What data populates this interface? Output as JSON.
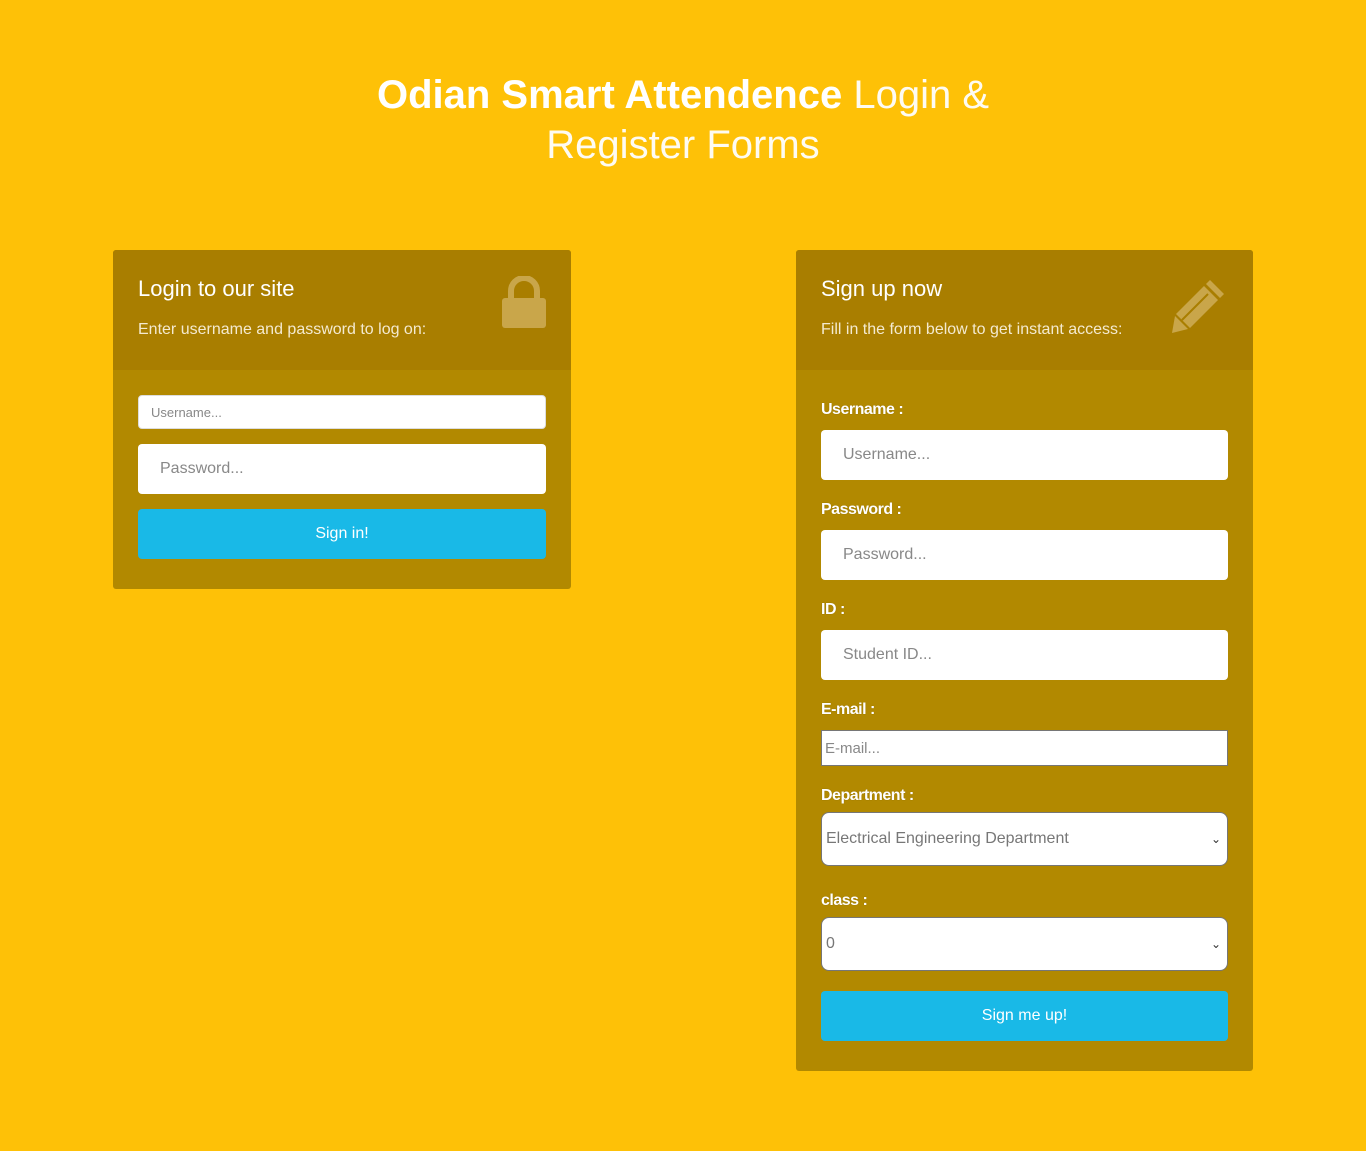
{
  "header": {
    "title_strong": "Odian Smart Attendence",
    "title_light": "Login & Register Forms"
  },
  "login": {
    "heading": "Login to our site",
    "subheading": "Enter username and password to log on:",
    "icon": "lock-icon",
    "username_placeholder": "Username...",
    "password_placeholder": "Password...",
    "submit_label": "Sign in!"
  },
  "signup": {
    "heading": "Sign up now",
    "subheading": "Fill in the form below to get instant access:",
    "icon": "pencil-icon",
    "username_label": "Username :",
    "username_placeholder": "Username...",
    "password_label": "Password :",
    "password_placeholder": "Password...",
    "id_label": "ID :",
    "id_placeholder": "Student ID...",
    "email_label": "E-mail :",
    "email_placeholder": "E-mail...",
    "department_label": "Department :",
    "department_selected": "Electrical Engineering Department",
    "class_label": "class :",
    "class_selected": "0",
    "submit_label": "Sign me up!"
  },
  "colors": {
    "background": "#fec107",
    "card": "#b28900",
    "card_header": "#a97e00",
    "button": "#19b9e7"
  }
}
